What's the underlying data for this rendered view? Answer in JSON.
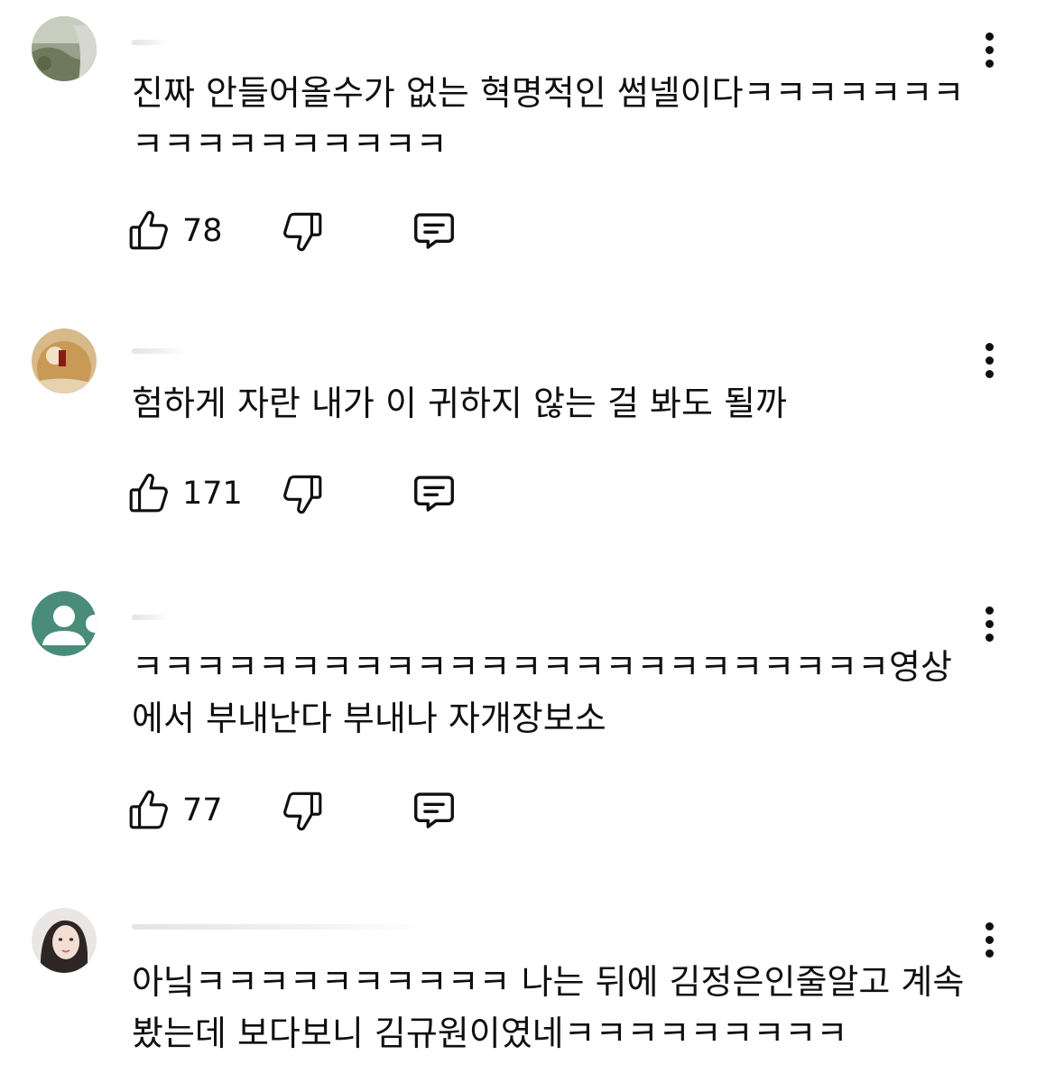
{
  "comments": [
    {
      "text": "진짜 안들어올수가 없는 혁명적인 썸넬이다ㅋㅋㅋㅋㅋㅋㅋㅋㅋㅋㅋㅋㅋㅋㅋㅋㅋ",
      "likes": "78",
      "avatar": "landscape-photo"
    },
    {
      "text": "험하게 자란 내가 이 귀하지 않는 걸 봐도 될까",
      "likes": "171",
      "avatar": "figure-photo"
    },
    {
      "text": "ㅋㅋㅋㅋㅋㅋㅋㅋㅋㅋㅋㅋㅋㅋㅋㅋㅋㅋㅋㅋㅋㅋㅋㅋ영상에서 부내난다 부내나 자개장보소",
      "likes": "77",
      "avatar": "default-person"
    },
    {
      "text": "아닠ㅋㅋㅋㅋㅋㅋㅋㅋㅋㅋ 나는 뒤에 김정은인줄알고 계속 봤는데 보다보니 김규원이였네ㅋㅋㅋㅋㅋㅋㅋㅋㅋ",
      "likes": "",
      "avatar": "portrait-photo"
    }
  ],
  "icons": {
    "like": "thumbs-up-icon",
    "dislike": "thumbs-down-icon",
    "reply": "comment-icon",
    "more": "more-vertical-icon"
  },
  "colors": {
    "text": "#0f0f0f",
    "background": "#ffffff",
    "default_avatar": "#4a8c7a"
  }
}
